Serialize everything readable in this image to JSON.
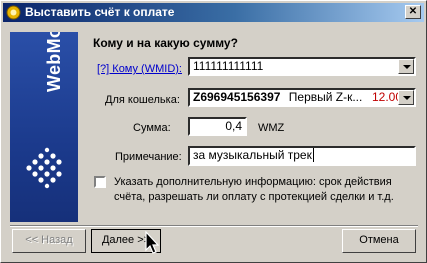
{
  "window": {
    "title": "Выставить счёт к оплате",
    "close_glyph": "✕"
  },
  "sidebar": {
    "brand": "WebMoney"
  },
  "form": {
    "heading": "Кому и на какую сумму?",
    "wmid_label": "[?] Кому (WMID):",
    "wmid_value": "111111111111",
    "wallet_label": "Для кошелька:",
    "wallet_number": "Z696945156397",
    "wallet_name": "Первый Z-к...",
    "wallet_balance": "12.00",
    "amount_label": "Сумма:",
    "amount_value": "0,4",
    "currency": "WMZ",
    "note_label": "Примечание:",
    "note_value": "за музыкальный трек",
    "extra_info_text": "Указать дополнительную информацию: срок действия счёта, разрешать ли оплату с протекцией сделки и т.д."
  },
  "buttons": {
    "back": "<< Назад",
    "next": "Далее >>",
    "cancel": "Отмена"
  },
  "colors": {
    "balance": "#c00000",
    "link": "#0000cc",
    "sidebar": "#1b3a8c"
  }
}
